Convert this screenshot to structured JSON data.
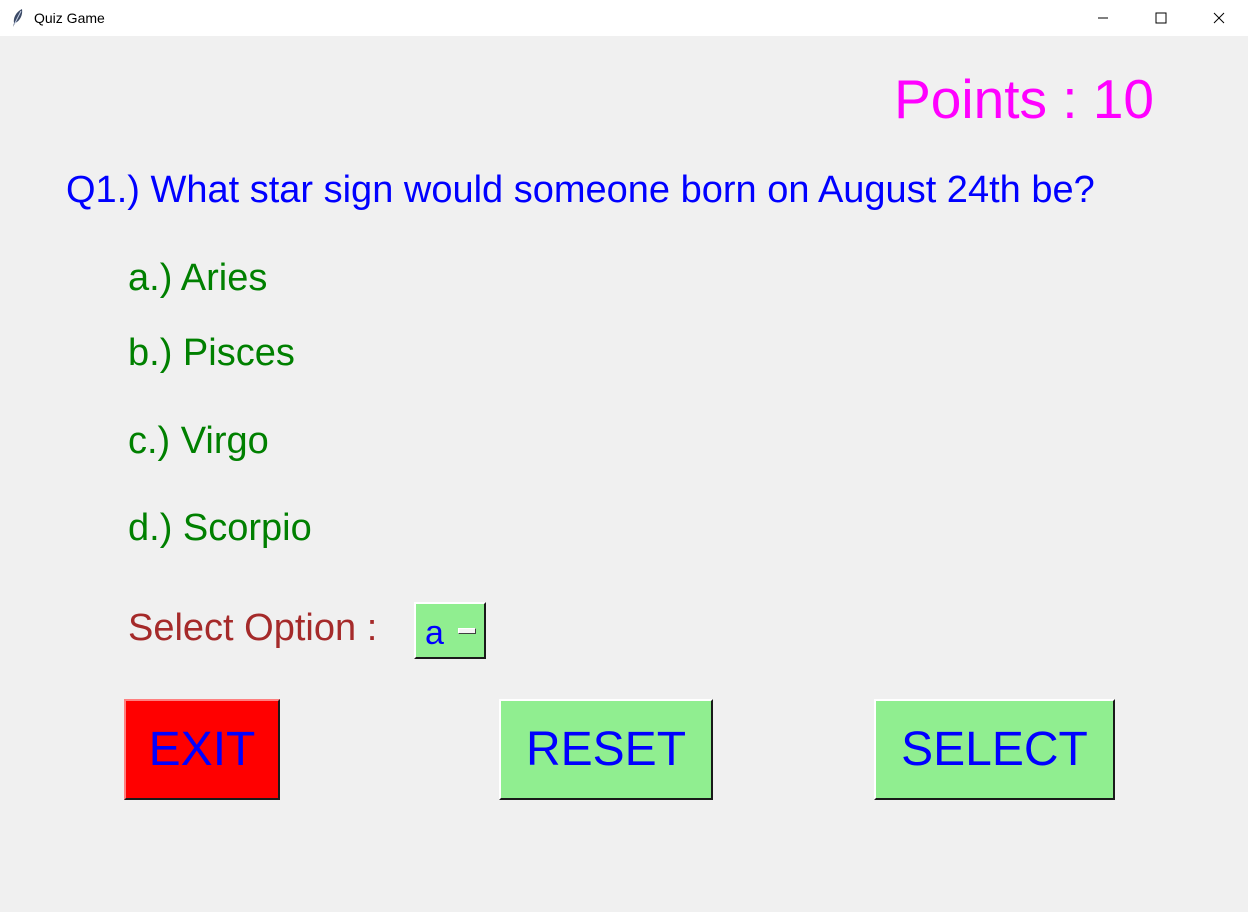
{
  "window": {
    "title": "Quiz Game"
  },
  "quiz": {
    "points_text": "Points : 10",
    "question": "Q1.) What star sign would someone born on August 24th be?",
    "options": [
      {
        "label": "a.) Aries"
      },
      {
        "label": "b.) Pisces"
      },
      {
        "label": "c.) Virgo"
      },
      {
        "label": "d.) Scorpio"
      }
    ],
    "select_label": "Select Option :",
    "selected_option": "a"
  },
  "buttons": {
    "exit": "EXIT",
    "reset": "RESET",
    "select": "SELECT"
  },
  "colors": {
    "points": "#ff00ff",
    "question": "#0000ff",
    "options": "#008000",
    "select_label": "#a52a2a",
    "button_text": "#0000ff",
    "exit_bg": "#ff0000",
    "green_bg": "#90ee90"
  },
  "icons": {
    "app": "feather-icon",
    "minimize": "minimize-icon",
    "maximize": "maximize-icon",
    "close": "close-icon"
  }
}
